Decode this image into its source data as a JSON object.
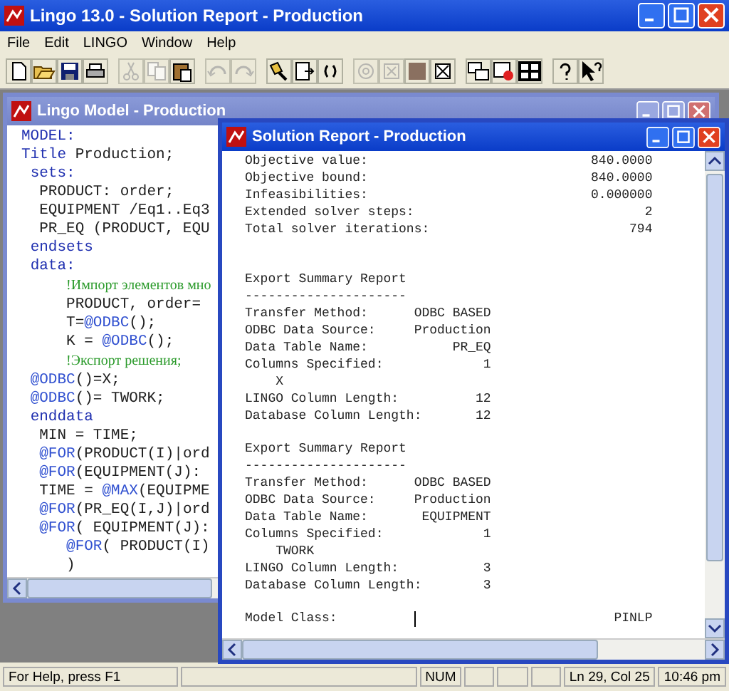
{
  "window": {
    "title": "Lingo 13.0 - Solution Report - Production"
  },
  "menu": [
    "File",
    "Edit",
    "LINGO",
    "Window",
    "Help"
  ],
  "toolbar": [
    {
      "buttons": [
        {
          "disabled": false
        },
        {
          "disabled": false
        },
        {
          "disabled": false
        },
        {
          "disabled": false
        }
      ]
    },
    {
      "buttons": [
        {
          "disabled": true
        },
        {
          "disabled": true
        },
        {
          "disabled": false
        }
      ]
    },
    {
      "buttons": [
        {
          "disabled": true
        },
        {
          "disabled": true
        }
      ]
    },
    {
      "buttons": [
        {
          "disabled": false
        },
        {
          "disabled": false
        },
        {
          "disabled": false
        }
      ]
    },
    {
      "buttons": [
        {
          "disabled": true
        },
        {
          "disabled": true
        },
        {
          "disabled": false
        },
        {
          "disabled": false
        }
      ]
    },
    {
      "buttons": [
        {
          "disabled": false
        },
        {
          "disabled": false
        },
        {
          "disabled": false
        }
      ]
    },
    {
      "buttons": [
        {
          "disabled": false
        },
        {
          "disabled": false
        }
      ]
    }
  ],
  "model_window": {
    "title": "Lingo Model - Production",
    "active": false,
    "lines": [
      {
        "segments": [
          {
            "kind": "keyword",
            "text": "MODEL:"
          }
        ]
      },
      {
        "segments": [
          {
            "kind": "keyword",
            "text": "Title"
          },
          {
            "kind": "plain",
            "text": " Production;"
          }
        ]
      },
      {
        "segments": [
          {
            "kind": "keyword",
            "text": " sets:"
          }
        ]
      },
      {
        "segments": [
          {
            "kind": "plain",
            "text": "  PRODUCT: order;"
          }
        ]
      },
      {
        "segments": [
          {
            "kind": "plain",
            "text": "  EQUIPMENT /Eq1..Eq3"
          }
        ]
      },
      {
        "segments": [
          {
            "kind": "plain",
            "text": "  PR_EQ (PRODUCT, EQU"
          }
        ]
      },
      {
        "segments": [
          {
            "kind": "keyword",
            "text": " endsets"
          }
        ]
      },
      {
        "segments": [
          {
            "kind": "keyword",
            "text": " data:"
          }
        ]
      },
      {
        "segments": [
          {
            "kind": "comment",
            "text": "     !Импорт элементов мно"
          }
        ]
      },
      {
        "segments": [
          {
            "kind": "plain",
            "text": "     PRODUCT, order="
          }
        ]
      },
      {
        "segments": [
          {
            "kind": "plain",
            "text": "     T="
          },
          {
            "kind": "function",
            "text": "@ODBC"
          },
          {
            "kind": "plain",
            "text": "();"
          }
        ]
      },
      {
        "segments": [
          {
            "kind": "plain",
            "text": "     K = "
          },
          {
            "kind": "function",
            "text": "@ODBC"
          },
          {
            "kind": "plain",
            "text": "();"
          }
        ]
      },
      {
        "segments": [
          {
            "kind": "comment",
            "text": "     !Экспорт решения;"
          }
        ]
      },
      {
        "segments": [
          {
            "kind": "function",
            "text": " @ODBC"
          },
          {
            "kind": "plain",
            "text": "()=X;"
          }
        ]
      },
      {
        "segments": [
          {
            "kind": "function",
            "text": " @ODBC"
          },
          {
            "kind": "plain",
            "text": "()= TWORK;"
          }
        ]
      },
      {
        "segments": [
          {
            "kind": "keyword",
            "text": " enddata"
          }
        ]
      },
      {
        "segments": [
          {
            "kind": "plain",
            "text": "  MIN = TIME;"
          }
        ]
      },
      {
        "segments": [
          {
            "kind": "function",
            "text": "  @FOR"
          },
          {
            "kind": "plain",
            "text": "(PRODUCT(I)|ord"
          }
        ]
      },
      {
        "segments": [
          {
            "kind": "function",
            "text": "  @FOR"
          },
          {
            "kind": "plain",
            "text": "(EQUIPMENT(J):"
          }
        ]
      },
      {
        "segments": [
          {
            "kind": "plain",
            "text": "  TIME = "
          },
          {
            "kind": "function",
            "text": "@MAX"
          },
          {
            "kind": "plain",
            "text": "(EQUIPME"
          }
        ]
      },
      {
        "segments": [
          {
            "kind": "function",
            "text": "  @FOR"
          },
          {
            "kind": "plain",
            "text": "(PR_EQ(I,J)|ord"
          }
        ]
      },
      {
        "segments": [
          {
            "kind": "function",
            "text": "  @FOR"
          },
          {
            "kind": "plain",
            "text": "( EQUIPMENT(J):"
          }
        ]
      },
      {
        "segments": [
          {
            "kind": "function",
            "text": "     @FOR"
          },
          {
            "kind": "plain",
            "text": "( PRODUCT(I)"
          }
        ]
      },
      {
        "segments": [
          {
            "kind": "plain",
            "text": "     )"
          }
        ]
      }
    ]
  },
  "report_window": {
    "title": "Solution Report - Production",
    "active": true,
    "blocks": [
      {
        "kind": "results",
        "lines": [
          {
            "label": "Objective value:",
            "value": "840.0000",
            "cursor": false
          },
          {
            "label": "Objective bound:",
            "value": "840.0000",
            "cursor": false
          },
          {
            "label": "Infeasibilities:",
            "value": "0.000000",
            "cursor": false
          },
          {
            "label": "Extended solver steps:",
            "value": "2",
            "cursor": false
          },
          {
            "label": "Total solver iterations:",
            "value": "794",
            "cursor": false
          }
        ]
      },
      {
        "kind": "export",
        "lines": [
          {
            "label": "Export Summary Report",
            "cursor": false
          },
          {
            "label": "---------------------",
            "cursor": false
          },
          {
            "label": "Transfer Method:",
            "value": "ODBC BASED",
            "cursor": false
          },
          {
            "label": "ODBC Data Source:",
            "value": "Production",
            "cursor": false
          },
          {
            "label": "Data Table Name:",
            "value": "PR_EQ",
            "cursor": false
          },
          {
            "label": "Columns Specified:",
            "value": "1",
            "cursor": false
          },
          {
            "label": "    X",
            "cursor": false
          },
          {
            "label": "LINGO Column Length:",
            "value": "12",
            "cursor": false
          },
          {
            "label": "Database Column Length:",
            "value": "12",
            "cursor": false
          }
        ]
      },
      {
        "kind": "export",
        "lines": [
          {
            "label": "Export Summary Report",
            "cursor": false
          },
          {
            "label": "---------------------",
            "cursor": false
          },
          {
            "label": "Transfer Method:",
            "value": "ODBC BASED",
            "cursor": false
          },
          {
            "label": "ODBC Data Source:",
            "value": "Production",
            "cursor": false
          },
          {
            "label": "Data Table Name:",
            "value": "EQUIPMENT",
            "cursor": false
          },
          {
            "label": "Columns Specified:",
            "value": "1",
            "cursor": false
          },
          {
            "label": "    TWORK",
            "cursor": false
          },
          {
            "label": "LINGO Column Length:",
            "value": "3",
            "cursor": false
          },
          {
            "label": "Database Column Length:",
            "value": "3",
            "cursor": false
          }
        ]
      },
      {
        "kind": "results",
        "lines": [
          {
            "label": "Model Class:",
            "value": "PINLP",
            "cursor": true
          }
        ]
      }
    ]
  },
  "status_bar": {
    "message": "For Help, press F1",
    "indicators": [
      "NUM",
      "Ln 29, Col 25",
      "10:46 pm"
    ]
  }
}
